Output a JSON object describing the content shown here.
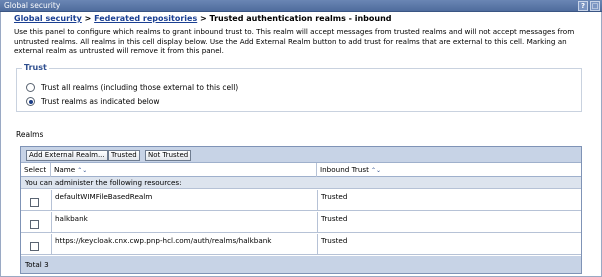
{
  "window": {
    "title": "Global security",
    "help_glyph": "?",
    "max_glyph": "□"
  },
  "breadcrumb": {
    "link1": "Global security",
    "sep1": " > ",
    "link2": "Federated repositories",
    "sep2": " > ",
    "current": "Trusted authentication realms - inbound"
  },
  "description": "Use this panel to configure which realms to grant inbound trust to. This realm will accept messages from trusted realms and will not accept messages from untrusted realms. All realms in this cell display below. Use the Add External Realm button to add trust for realms that are external to this cell. Marking an external realm as untrusted will remove it from this panel.",
  "trust": {
    "legend": "Trust",
    "options": [
      {
        "label": "Trust all realms (including those external to this cell)",
        "selected": false
      },
      {
        "label": "Trust realms as indicated below",
        "selected": true
      }
    ]
  },
  "realms": {
    "label": "Realms",
    "toolbar": {
      "add_external": "Add External Realm...",
      "trusted": "Trusted",
      "not_trusted": "Not Trusted"
    },
    "columns": {
      "select": "Select",
      "name": "Name",
      "inbound_trust": "Inbound Trust",
      "sort_glyph": "⌃⌄"
    },
    "admin_note": "You can administer the following resources:",
    "rows": [
      {
        "name": "defaultWIMFileBasedRealm",
        "trust": "Trusted",
        "checked": false
      },
      {
        "name": "halkbank",
        "trust": "Trusted",
        "checked": false
      },
      {
        "name": "https://keycloak.cnx.cwp.pnp-hcl.com/auth/realms/halkbank",
        "trust": "Trusted",
        "checked": false
      }
    ],
    "total": "Total 3"
  }
}
